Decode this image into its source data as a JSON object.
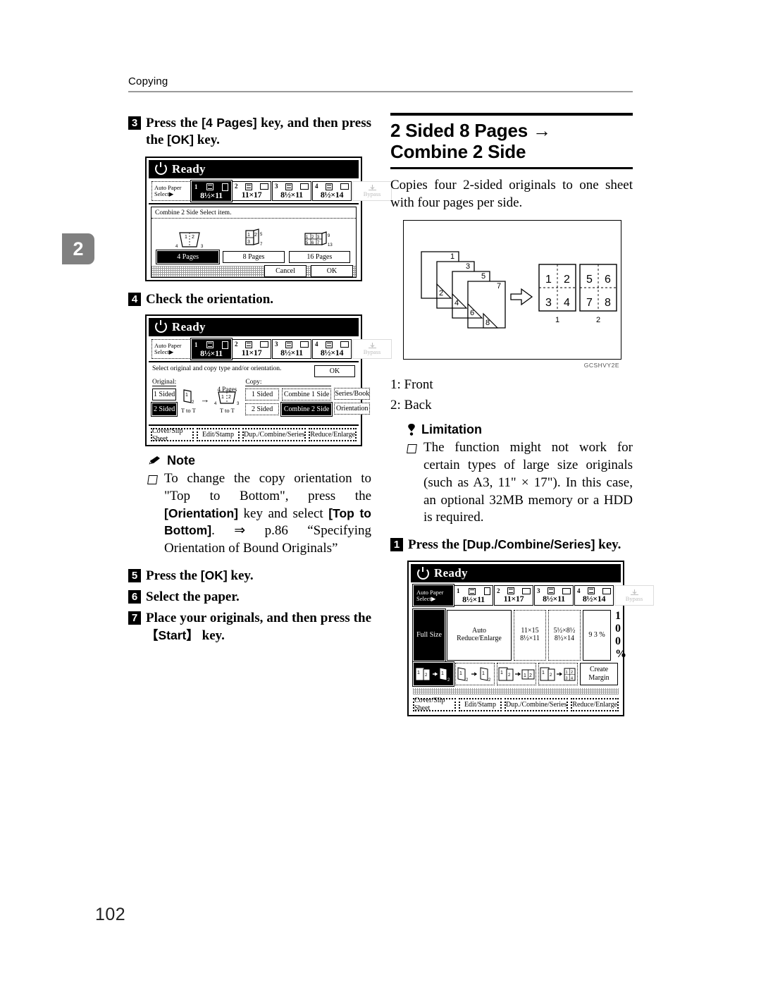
{
  "page": {
    "running_head": "Copying",
    "folio": "102",
    "chapter_tab": "2"
  },
  "left_column": {
    "step3": {
      "num": "3",
      "text_parts": [
        "Press the ",
        "[4 Pages]",
        " key, and then press the ",
        "[OK]",
        " key."
      ]
    },
    "step4": {
      "num": "4",
      "text": "Check the orientation."
    },
    "note": {
      "icon": "pencil-icon",
      "label": "Note",
      "items": [
        {
          "parts": [
            {
              "t": "To change the copy orientation to \"Top to Bottom\", press the ",
              "b": false
            },
            {
              "t": "[Orientation]",
              "b": true
            },
            {
              "t": " key and select ",
              "b": false
            },
            {
              "t": "[Top to Bottom]",
              "b": true
            },
            {
              "t": ". ⇒ p.86 “Specifying Orientation of Bound Originals”",
              "b": false
            }
          ]
        }
      ]
    },
    "step5": {
      "num": "5",
      "pre": "Press the ",
      "key": "[OK]",
      "post": " key."
    },
    "step6": {
      "num": "6",
      "text": "Select the paper."
    },
    "step7": {
      "num": "7",
      "pre": "Place your originals, and then press the ",
      "key": "【Start】",
      "post": " key."
    }
  },
  "right_column": {
    "section_title": "2 Sided 8 Pages → Combine 2 Side",
    "intro": "Copies four 2-sided originals to one sheet with four pages per side.",
    "figure": {
      "caption_id": "GCSHVY2E",
      "original_labels": [
        "1",
        "3",
        "2",
        "5",
        "4",
        "7",
        "6",
        "8"
      ],
      "sheet1": {
        "cells": [
          "1",
          "2",
          "3",
          "4"
        ],
        "label": "1"
      },
      "sheet2": {
        "cells": [
          "5",
          "6",
          "7",
          "8"
        ],
        "label": "2"
      }
    },
    "legend": [
      "1: Front",
      "2: Back"
    ],
    "limitation": {
      "icon": "exclamation-icon",
      "label": "Limitation",
      "items": [
        "The function might not work for certain types of large size originals (such as A3, 11\" × 17\"). In this case, an optional 32MB memory or a HDD is required."
      ]
    },
    "step1": {
      "num": "1",
      "pre": "Press the ",
      "key": "[Dup./Combine/Series]",
      "post": " key."
    }
  },
  "lcd_panels": {
    "panel1": {
      "status": "Ready",
      "tray_auto": {
        "line1": "Auto Paper",
        "line2": "Select▶"
      },
      "trays": [
        {
          "num": "1",
          "size": "8½×11",
          "orientation": "portrait",
          "selected": true
        },
        {
          "num": "2",
          "size": "11×17",
          "orientation": "landscape",
          "selected": false
        },
        {
          "num": "3",
          "size": "8½×11",
          "orientation": "landscape",
          "selected": false
        },
        {
          "num": "4",
          "size": "8½×14",
          "orientation": "landscape",
          "selected": false
        }
      ],
      "bypass": "Bypass",
      "dialog_title": "Combine 2 Side    Select item.",
      "options": [
        {
          "label": "4 Pages",
          "selected": true
        },
        {
          "label": "8 Pages",
          "selected": false
        },
        {
          "label": "16 Pages",
          "selected": false
        }
      ],
      "cancel": "Cancel",
      "ok": "OK"
    },
    "panel2": {
      "status": "Ready",
      "tray_auto": {
        "line1": "Auto Paper",
        "line2": "Select▶"
      },
      "trays": [
        {
          "num": "1",
          "size": "8½×11",
          "orientation": "portrait",
          "selected": true
        },
        {
          "num": "2",
          "size": "11×17",
          "orientation": "landscape",
          "selected": false
        },
        {
          "num": "3",
          "size": "8½×11",
          "orientation": "landscape",
          "selected": false
        },
        {
          "num": "4",
          "size": "8½×14",
          "orientation": "landscape",
          "selected": false
        }
      ],
      "bypass": "Bypass",
      "hint": "Select original and copy type and/or orientation.",
      "ok": "OK",
      "original_label": "Original:",
      "copy_label": "Copy:",
      "pages_label": "4 Pages",
      "original_buttons": [
        {
          "label": "1 Sided",
          "selected": false
        },
        {
          "label": "2 Sided",
          "selected": true
        }
      ],
      "orig_ttl": "T to T",
      "copy_ttl": "T to T",
      "copy_buttons": [
        {
          "label": "1 Sided",
          "selected": false
        },
        {
          "label": "Combine 1 Side",
          "selected": false
        },
        {
          "label": "2 Sided",
          "selected": false
        },
        {
          "label": "Combine 2 Side",
          "selected": true
        }
      ],
      "side_buttons": [
        {
          "label": "Series/Book",
          "selected": false
        },
        {
          "label": "Orientation",
          "selected": false
        }
      ],
      "tabs": [
        "Cover/Slip Sheet",
        "Edit/Stamp",
        "Dup./Combine/Series",
        "Reduce/Enlarge"
      ]
    },
    "panel3": {
      "status": "Ready",
      "tray_auto": {
        "line1": "Auto Paper",
        "line2": "Select▶"
      },
      "trays": [
        {
          "num": "1",
          "size": "8½×11",
          "orientation": "portrait",
          "selected": false
        },
        {
          "num": "2",
          "size": "11×17",
          "orientation": "landscape",
          "selected": false
        },
        {
          "num": "3",
          "size": "8½×11",
          "orientation": "landscape",
          "selected": false
        },
        {
          "num": "4",
          "size": "8½×14",
          "orientation": "landscape",
          "selected": false
        }
      ],
      "bypass": "Bypass",
      "zoom_buttons": [
        {
          "label": "Full Size",
          "selected": true
        },
        {
          "label": "Auto Reduce/Enlarge",
          "selected": false
        },
        {
          "label": "11×15\n8½×11",
          "selected": false
        },
        {
          "label": "5½×8½\n8½×14",
          "selected": false
        },
        {
          "label": "9 3 %",
          "selected": false
        }
      ],
      "zoom_value": "1 0 0 %",
      "create_margin": "Create\nMargin",
      "tabs": [
        "Cover/Slip Sheet",
        "Edit/Stamp",
        "Dup./Combine/Series",
        "Reduce/Enlarge"
      ]
    }
  },
  "colors": {
    "chapter_tab_bg": "#808080",
    "rule_gray": "#9a9a9a",
    "ink": "#000000",
    "paper": "#ffffff"
  }
}
